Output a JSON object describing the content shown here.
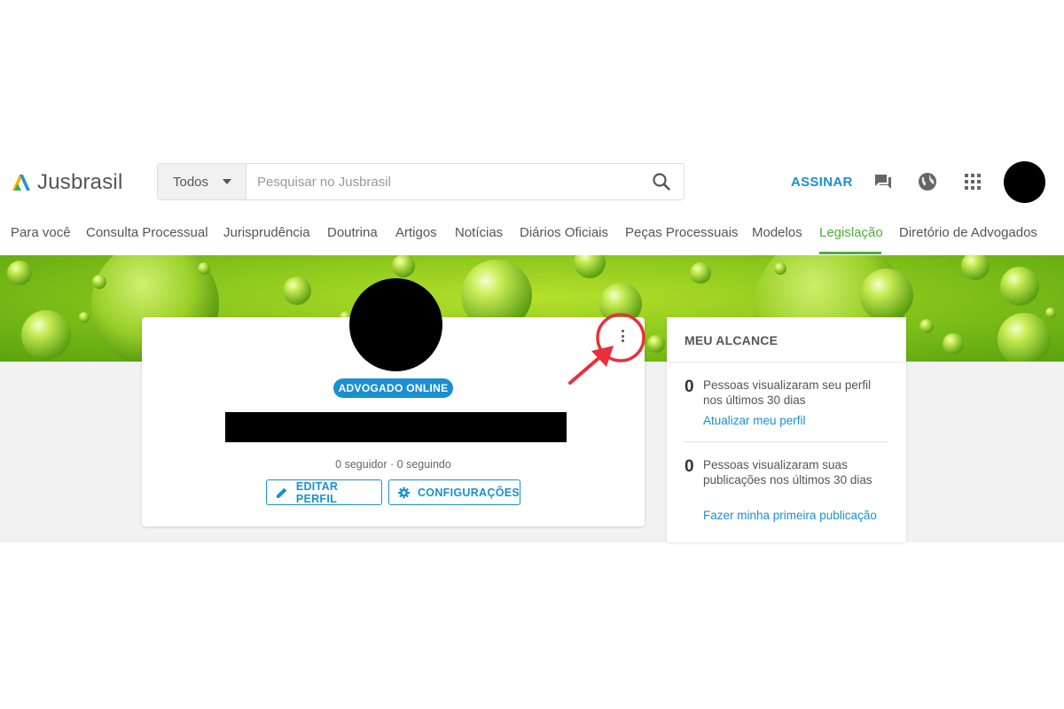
{
  "header": {
    "logo_text": "Jusbrasil",
    "search": {
      "scope": "Todos",
      "placeholder": "Pesquisar no Jusbrasil"
    },
    "subscribe_label": "ASSINAR"
  },
  "nav": {
    "items": [
      {
        "label": "Para você"
      },
      {
        "label": "Consulta Processual"
      },
      {
        "label": "Jurisprudência"
      },
      {
        "label": "Doutrina"
      },
      {
        "label": "Artigos"
      },
      {
        "label": "Notícias"
      },
      {
        "label": "Diários Oficiais"
      },
      {
        "label": "Peças Processuais"
      },
      {
        "label": "Modelos"
      },
      {
        "label": "Legislação"
      },
      {
        "label": "Diretório de Advogados"
      }
    ],
    "active_item": "Legislação"
  },
  "profile": {
    "badge": "ADVOGADO ONLINE",
    "followers_text": "0 seguidor  ·  0 seguindo",
    "edit_label": "EDITAR PERFIL",
    "settings_label": "CONFIGURAÇÕES"
  },
  "reach": {
    "title": "MEU ALCANCE",
    "stats": [
      {
        "value": "0",
        "text": "Pessoas visualizaram seu perfil nos últimos 30 dias",
        "link": "Atualizar meu perfil"
      },
      {
        "value": "0",
        "text": "Pessoas visualizaram suas publicações nos últimos 30 dias",
        "link": "Fazer minha primeira publicação"
      }
    ]
  },
  "colors": {
    "accent_blue": "#1b8fd1",
    "accent_green": "#4fae3c",
    "annotation_red": "#e8303a"
  }
}
